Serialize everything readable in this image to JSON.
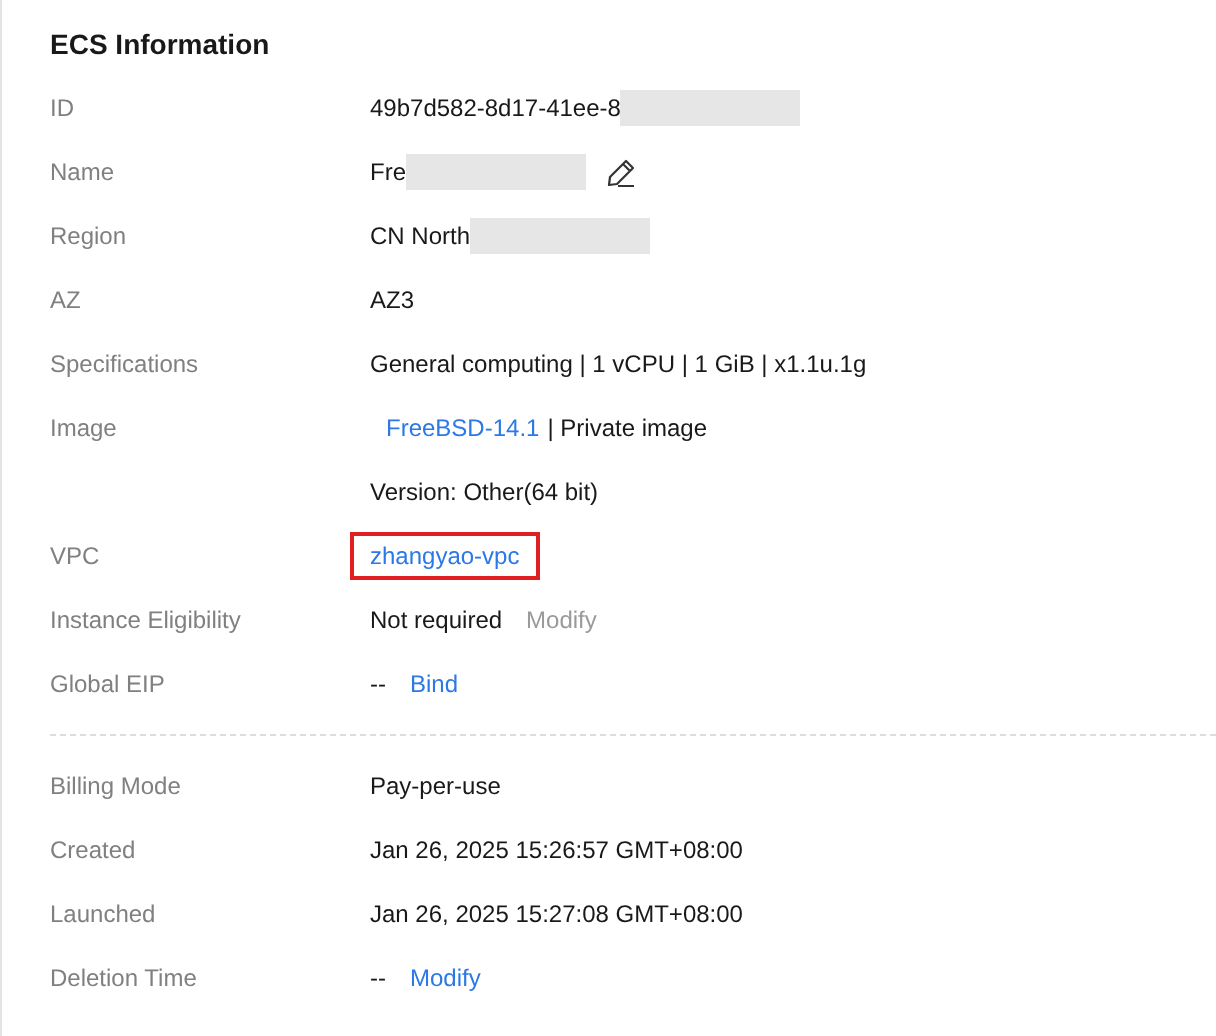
{
  "title": "ECS Information",
  "sections": [
    {
      "rows": [
        {
          "label": "ID",
          "lines": [
            [
              {
                "kind": "text",
                "text": "49b7d582-8d17-41ee-8"
              },
              {
                "kind": "redacted"
              }
            ]
          ]
        },
        {
          "label": "Name",
          "lines": [
            [
              {
                "kind": "text",
                "text": "Fre"
              },
              {
                "kind": "redacted"
              },
              {
                "kind": "edit"
              }
            ]
          ]
        },
        {
          "label": "Region",
          "lines": [
            [
              {
                "kind": "text",
                "text": "CN North"
              },
              {
                "kind": "redacted"
              }
            ]
          ]
        },
        {
          "label": "AZ",
          "lines": [
            [
              {
                "kind": "text",
                "text": "AZ3"
              }
            ]
          ]
        },
        {
          "label": "Specifications",
          "lines": [
            [
              {
                "kind": "text",
                "text": "General computing | 1 vCPU | 1 GiB | x1.1u.1g"
              }
            ]
          ]
        },
        {
          "label": "Image",
          "lines": [
            [
              {
                "kind": "link",
                "text": "FreeBSD-14.1",
                "disabled": false,
                "highlighted": false
              },
              {
                "kind": "text",
                "text": "| Private image"
              }
            ],
            [
              {
                "kind": "text",
                "text": "Version: Other(64 bit)"
              }
            ]
          ]
        },
        {
          "label": "VPC",
          "lines": [
            [
              {
                "kind": "link",
                "text": "zhangyao-vpc",
                "disabled": false,
                "highlighted": true
              }
            ]
          ]
        },
        {
          "label": "Instance Eligibility",
          "lines": [
            [
              {
                "kind": "text",
                "text": "Not required"
              },
              {
                "kind": "link",
                "text": "Modify",
                "disabled": true,
                "highlighted": false
              }
            ]
          ]
        },
        {
          "label": "Global EIP",
          "lines": [
            [
              {
                "kind": "text",
                "text": "--"
              },
              {
                "kind": "link",
                "text": "Bind",
                "disabled": false,
                "highlighted": false
              }
            ]
          ]
        }
      ]
    },
    {
      "rows": [
        {
          "label": "Billing Mode",
          "lines": [
            [
              {
                "kind": "text",
                "text": "Pay-per-use"
              }
            ]
          ]
        },
        {
          "label": "Created",
          "lines": [
            [
              {
                "kind": "text",
                "text": "Jan 26, 2025 15:26:57 GMT+08:00"
              }
            ]
          ]
        },
        {
          "label": "Launched",
          "lines": [
            [
              {
                "kind": "text",
                "text": "Jan 26, 2025 15:27:08 GMT+08:00"
              }
            ]
          ]
        },
        {
          "label": "Deletion Time",
          "lines": [
            [
              {
                "kind": "text",
                "text": "--"
              },
              {
                "kind": "link",
                "text": "Modify",
                "disabled": false,
                "highlighted": false
              }
            ]
          ]
        }
      ]
    }
  ]
}
